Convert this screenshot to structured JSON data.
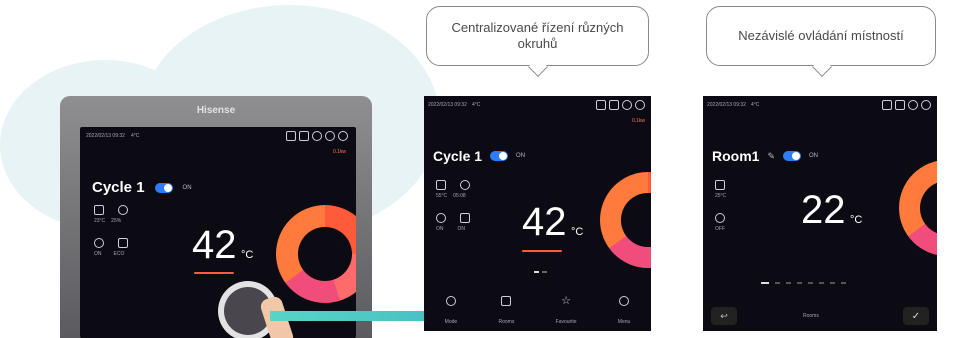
{
  "device": {
    "brand": "Hisense",
    "status_date": "2022/02/13  09:32",
    "status_temp": "4°C",
    "status_right": "0.1kw",
    "cycle_label": "Cycle 1",
    "toggle_label": "ON",
    "temperature": "42",
    "unit": "°C",
    "set_temps": [
      "23°C",
      "25%"
    ],
    "modes": [
      "ON",
      "ECO"
    ]
  },
  "panel_cycle": {
    "status_date": "2022/02/13  09:32",
    "status_temp": "4°C",
    "status_right": "0.1kw",
    "title": "Cycle 1",
    "toggle_label": "ON",
    "temperature": "42",
    "unit": "°C",
    "mini_values": [
      "55°C",
      "05:08",
      "ON",
      "ON"
    ],
    "nav": [
      "Mode",
      "Rooms",
      "Favourite",
      "Menu"
    ]
  },
  "panel_room": {
    "status_date": "2022/02/13  09:32",
    "status_temp": "4°C",
    "title": "Room1",
    "toggle_label": "ON",
    "temperature": "22",
    "unit": "°C",
    "mini_values": [
      "25°C",
      "OFF"
    ],
    "footer_label": "Rooms"
  },
  "callouts": {
    "left": "Centralizované řízení různých okruhů",
    "right": "Nezávislé ovládání místností"
  },
  "colors": {
    "accent_blue": "#2e7cf6",
    "ring_orange": "#ff5a3a",
    "arrow_teal": "#4fc7c4"
  }
}
